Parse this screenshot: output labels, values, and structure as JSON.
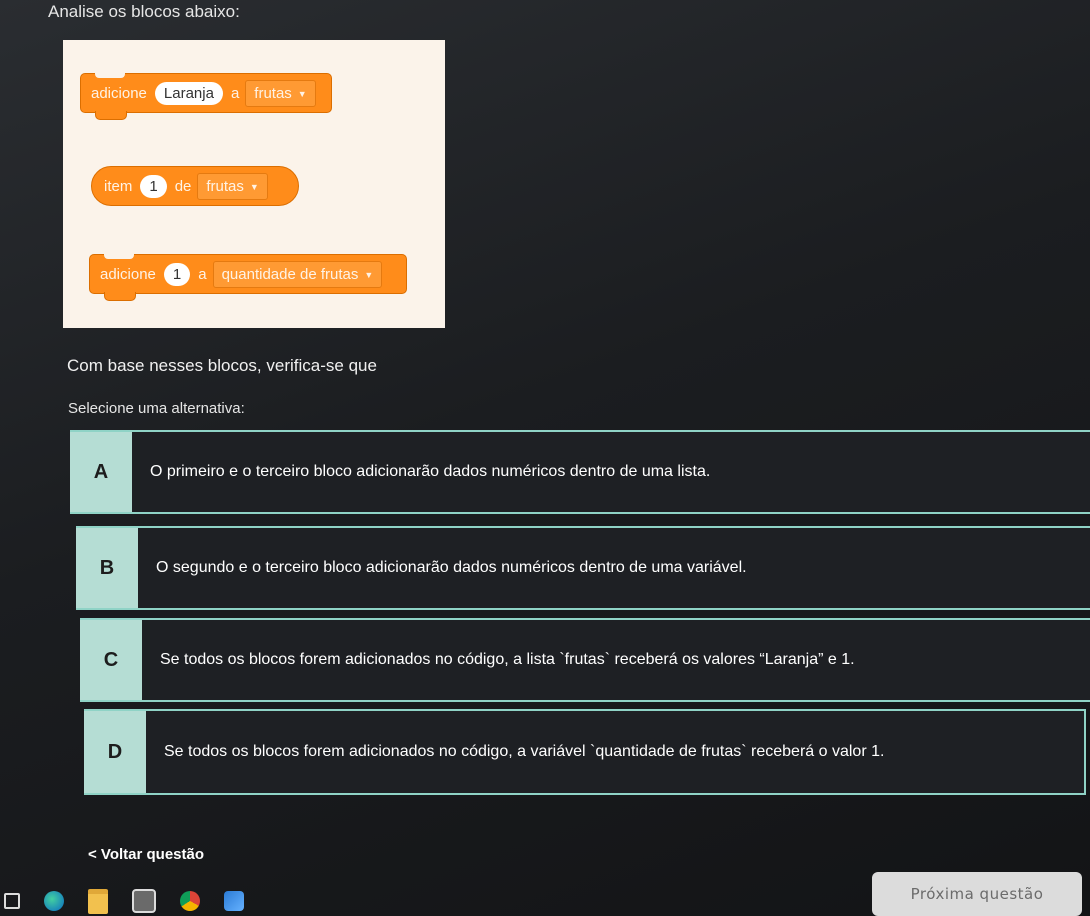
{
  "question": {
    "title": "Analise os blocos abaixo:",
    "prompt": "Com base nesses blocos, verifica-se que",
    "select_label": "Selecione uma alternativa:"
  },
  "blocks": {
    "block1": {
      "keyword": "adicione",
      "value": "Laranja",
      "connector": "a",
      "list": "frutas"
    },
    "block2": {
      "keyword": "item",
      "value": "1",
      "connector": "de",
      "list": "frutas"
    },
    "block3": {
      "keyword": "adicione",
      "value": "1",
      "connector": "a",
      "variable": "quantidade de frutas"
    }
  },
  "options": [
    {
      "letter": "A",
      "text": "O primeiro e o terceiro bloco adicionarão dados numéricos dentro de uma lista."
    },
    {
      "letter": "B",
      "text": "O segundo e o terceiro bloco adicionarão dados numéricos dentro de uma variável."
    },
    {
      "letter": "C",
      "text": "Se todos os blocos forem adicionados no código, a lista `frutas` receberá os valores “Laranja” e 1."
    },
    {
      "letter": "D",
      "text": "Se todos os blocos forem adicionados no código, a variável `quantidade de frutas` receberá o valor 1."
    }
  ],
  "navigation": {
    "back_label": "< Voltar questão",
    "next_label": "Próxima questão"
  },
  "taskbar": {
    "icons": [
      "task-view-icon",
      "edge-icon",
      "file-explorer-icon",
      "store-icon",
      "chrome-icon",
      "photos-icon"
    ]
  }
}
